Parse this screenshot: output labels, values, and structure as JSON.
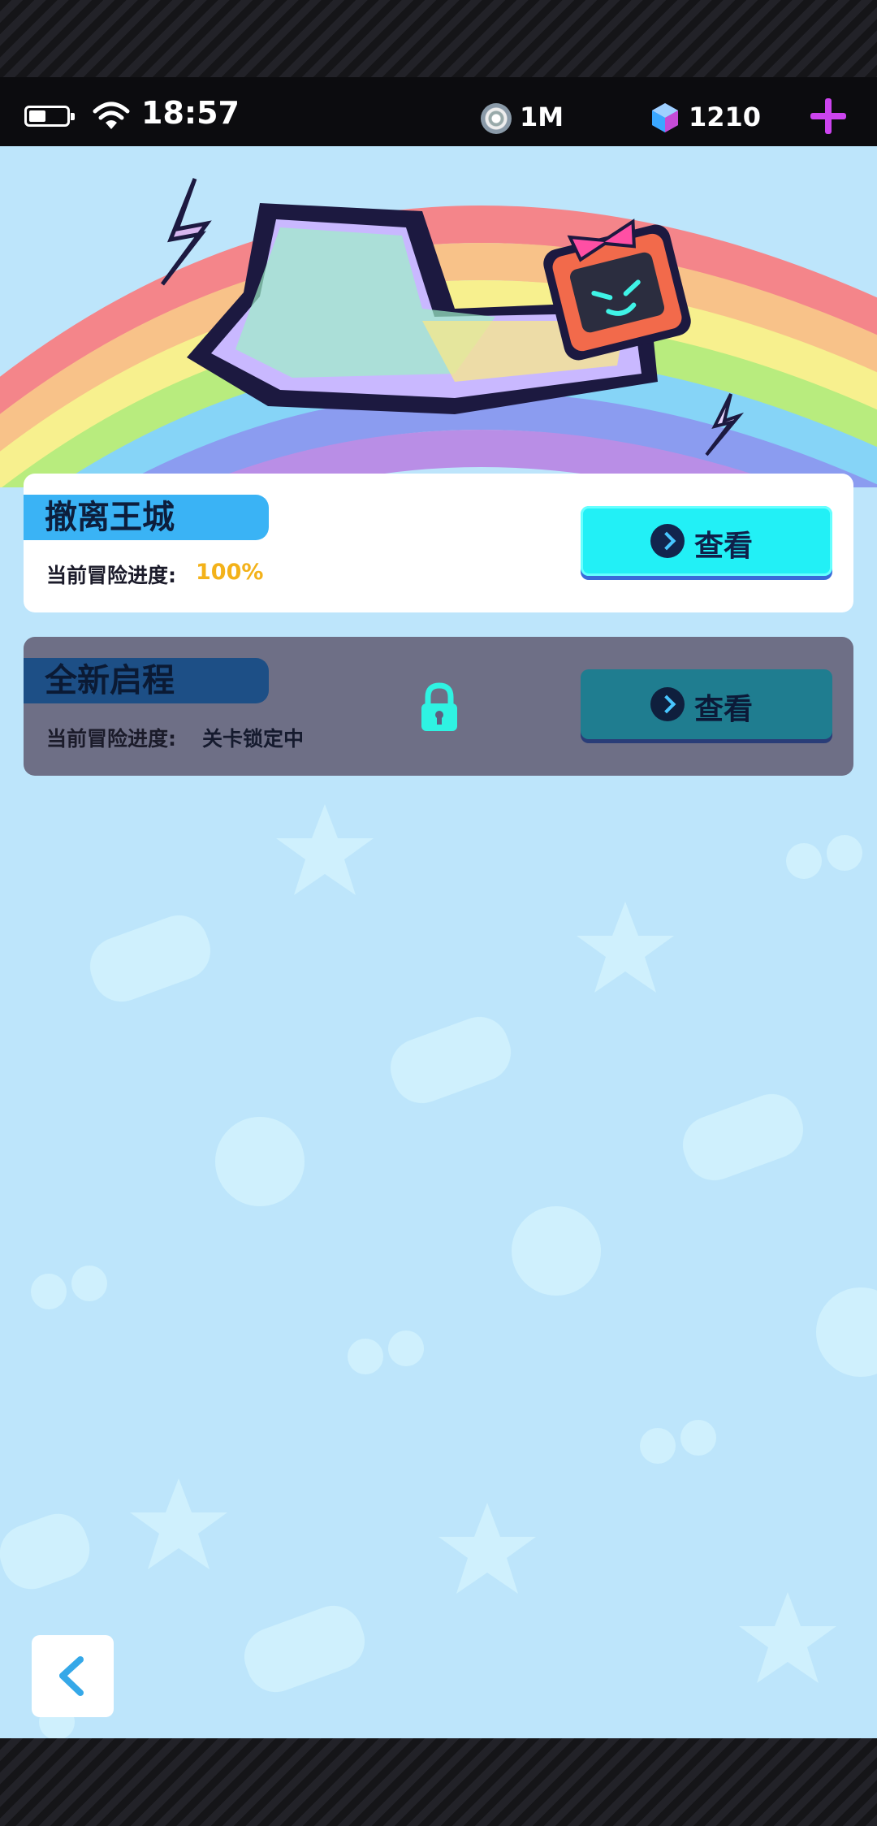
{
  "status_bar": {
    "time": "18:57",
    "battery_level": 0.45,
    "coins": "1M",
    "gems": "1210"
  },
  "colors": {
    "accent_cyan": "#22f0f6",
    "progress_gold": "#f3b21a",
    "plus_purple": "#cc44ee",
    "background": "#bde5fb"
  },
  "stages": [
    {
      "title": "撤离王城",
      "progress_label": "当前冒险进度:",
      "progress_value": "100%",
      "button_label": "查看",
      "locked": false
    },
    {
      "title": "全新启程",
      "progress_label": "当前冒险进度:",
      "progress_value": "关卡锁定中",
      "button_label": "查看",
      "locked": true
    }
  ],
  "icons": {
    "battery": "battery-icon",
    "wifi": "wifi-icon",
    "coin": "coin-icon",
    "gem": "gem-icon",
    "plus": "plus-icon",
    "lock": "lock-icon",
    "arrow": "chevron-right-icon",
    "back": "chevron-left-icon"
  }
}
